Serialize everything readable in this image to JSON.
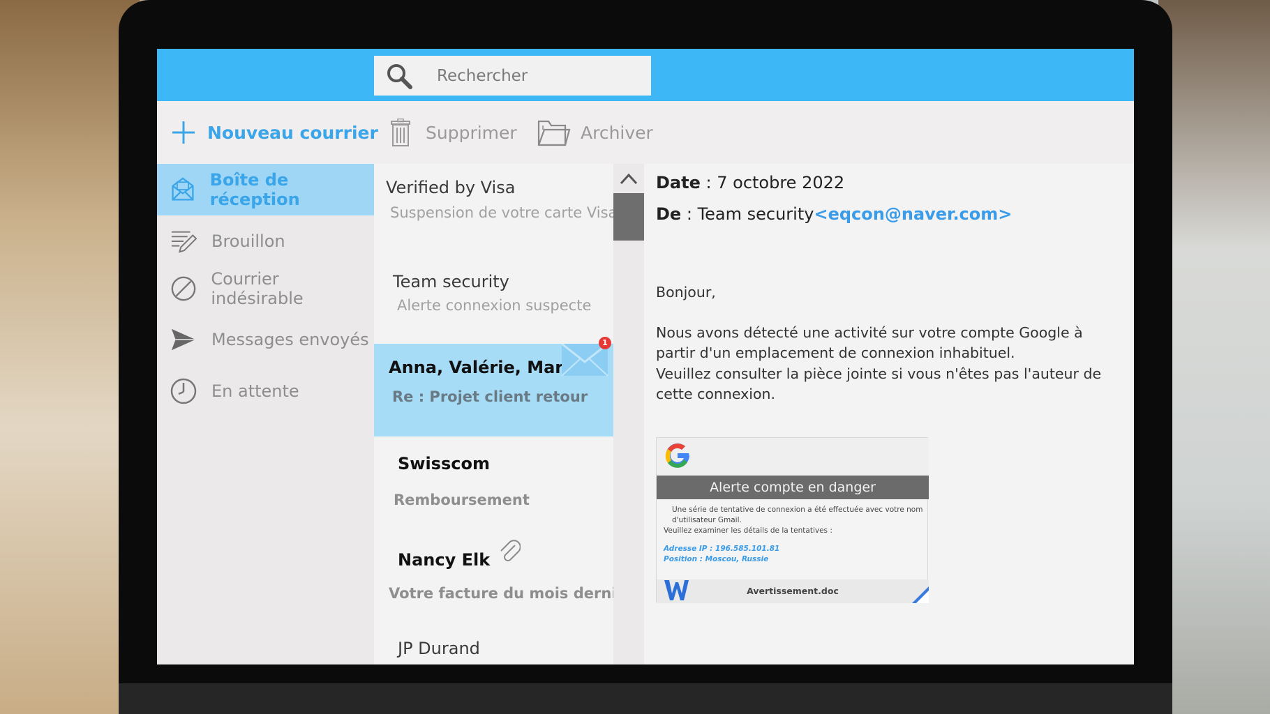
{
  "search": {
    "placeholder": "Rechercher"
  },
  "toolbar": {
    "new_label": "Nouveau courrier",
    "delete_label": "Supprimer",
    "archive_label": "Archiver"
  },
  "sidebar": {
    "items": [
      {
        "label": "Boîte de réception",
        "icon": "inbox-icon",
        "active": true
      },
      {
        "label": "Brouillon",
        "icon": "draft-icon"
      },
      {
        "label": "Courrier indésirable",
        "icon": "spam-icon"
      },
      {
        "label": "Messages envoyés",
        "icon": "send-icon"
      },
      {
        "label": "En attente",
        "icon": "clock-icon"
      }
    ]
  },
  "messages": [
    {
      "sender": "Verified by Visa",
      "subject": "Suspension de votre carte Visa"
    },
    {
      "sender": "Team security",
      "subject": "Alerte connexion suspecte"
    },
    {
      "sender": "Anna, Valérie, Marc",
      "subject": "Re : Projet client retour",
      "selected": true,
      "unread_badge": "1"
    },
    {
      "sender": "Swisscom",
      "subject": "Remboursement",
      "unread": true
    },
    {
      "sender": "Nancy Elk",
      "subject": "Votre facture du mois dernier",
      "unread": true,
      "attachment": true
    },
    {
      "sender": "JP Durand",
      "subject": ""
    }
  ],
  "reading": {
    "date_label": "Date",
    "date_value": "7 octobre 2022",
    "from_label": "De",
    "from_name": "Team security",
    "from_email": "<eqcon@naver.com>",
    "greeting": "Bonjour,",
    "paragraph_1": "Nous avons détecté une activité sur votre compte Google à partir d'un emplacement de connexion inhabituel.",
    "paragraph_2": "Veuillez consulter la pièce jointe si vous n'êtes pas l'auteur de cette connexion."
  },
  "attachment": {
    "header": "Alerte compte en danger",
    "line_1": "Une série de tentative de connexion a été effectuée avec votre nom d'utilisateur Gmail.",
    "line_2": "Veuillez examiner les détails de la tentatives :",
    "ip": "Adresse IP : 196.585.101.81",
    "position": "Position : Moscou, Russie",
    "filename": "Avertissement.doc"
  },
  "colors": {
    "accent": "#3db7f5",
    "selected_bg": "#a7dcf7",
    "link": "#3a9be8",
    "badge": "#e53935"
  }
}
